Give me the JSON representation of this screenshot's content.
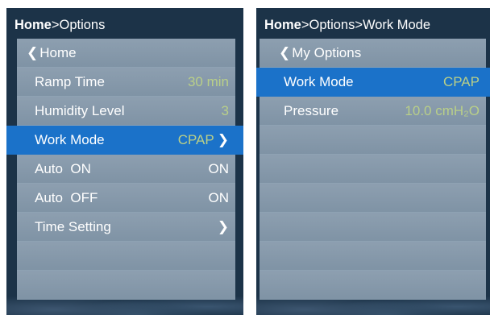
{
  "left": {
    "breadcrumb": {
      "home": "Home",
      "rest": ">Options"
    },
    "back": {
      "chevron": "❮",
      "label": "Home"
    },
    "items": [
      {
        "label": "Ramp Time",
        "value": "30 min"
      },
      {
        "label": "Humidity Level",
        "value": "3"
      },
      {
        "label": "Work Mode",
        "value": "CPAP",
        "chevron": "❯"
      },
      {
        "label": "Auto  ON",
        "value": "ON"
      },
      {
        "label": "Auto  OFF",
        "value": "ON"
      },
      {
        "label": "Time Setting",
        "value": "",
        "chevron": "❯"
      }
    ]
  },
  "right": {
    "breadcrumb": {
      "home": "Home",
      "rest": ">Options>Work Mode"
    },
    "back": {
      "chevron": "❮",
      "label": "My Options"
    },
    "items": [
      {
        "label": "Work Mode",
        "value": "CPAP"
      },
      {
        "label": "Pressure",
        "value": "10.0 cmH₂O"
      }
    ]
  },
  "colors": {
    "screen_bg": "#1c3348",
    "row_bg": "#8d9fb0",
    "selected": "#1b72c9",
    "dim_value": "#b9cf88"
  }
}
